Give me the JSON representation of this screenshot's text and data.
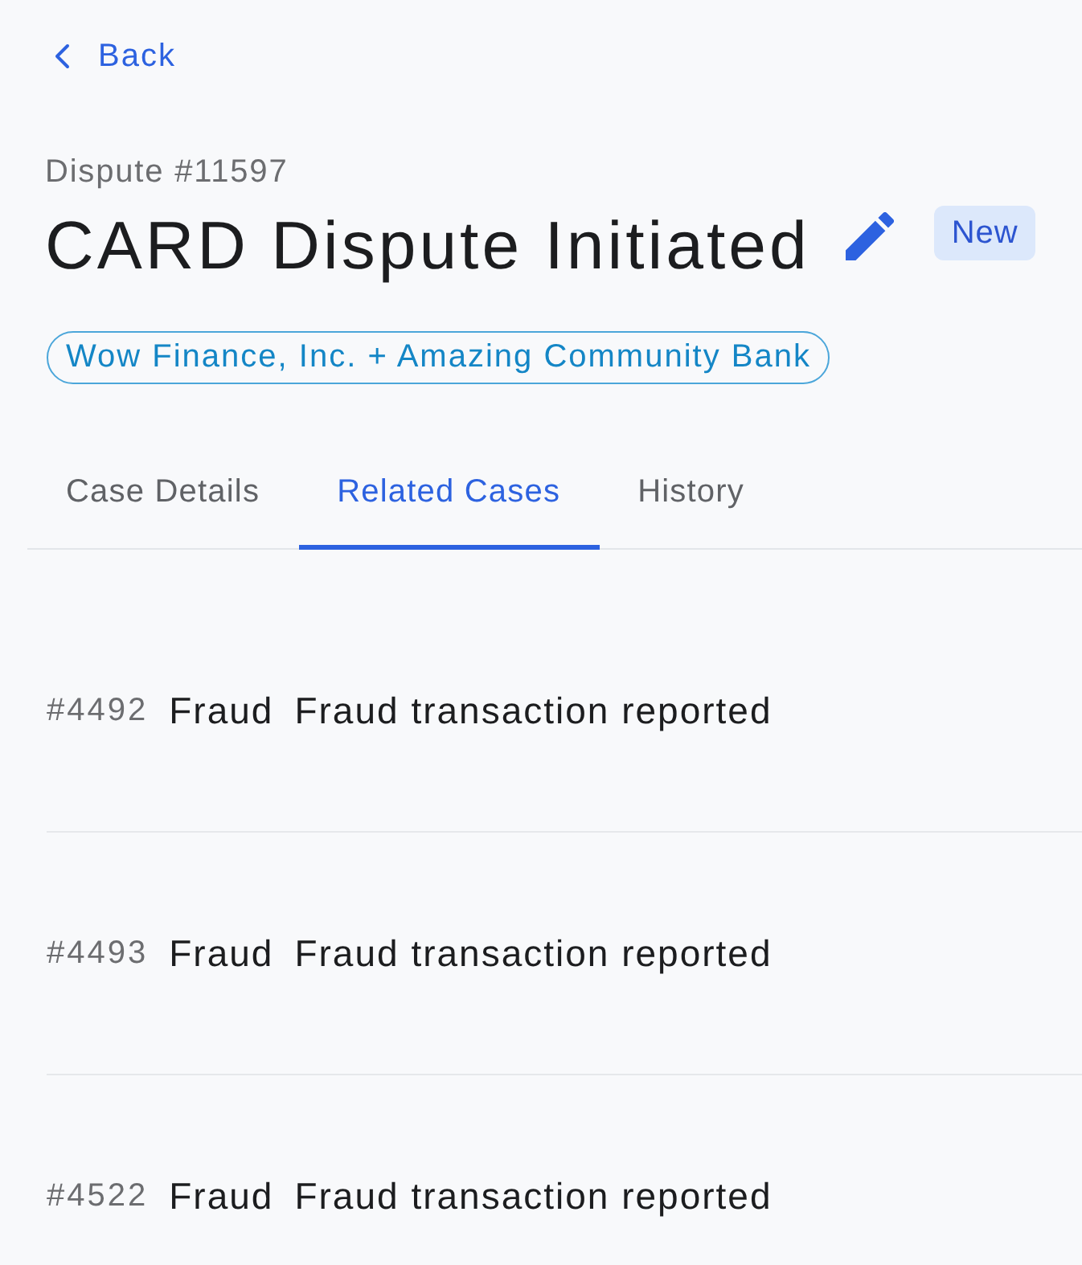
{
  "back": {
    "label": "Back"
  },
  "header": {
    "case_number": "Dispute #11597",
    "title": "CARD Dispute Initiated",
    "status": "New",
    "parties": "Wow Finance, Inc. + Amazing Community Bank"
  },
  "tabs": [
    {
      "label": "Case Details",
      "selected": false
    },
    {
      "label": "Related Cases",
      "selected": true
    },
    {
      "label": "History",
      "selected": false
    }
  ],
  "related_cases": [
    {
      "number": "#4492",
      "type": "Fraud",
      "description": "Fraud transaction reported"
    },
    {
      "number": "#4493",
      "type": "Fraud",
      "description": "Fraud transaction reported"
    },
    {
      "number": "#4522",
      "type": "Fraud",
      "description": "Fraud transaction reported"
    }
  ]
}
